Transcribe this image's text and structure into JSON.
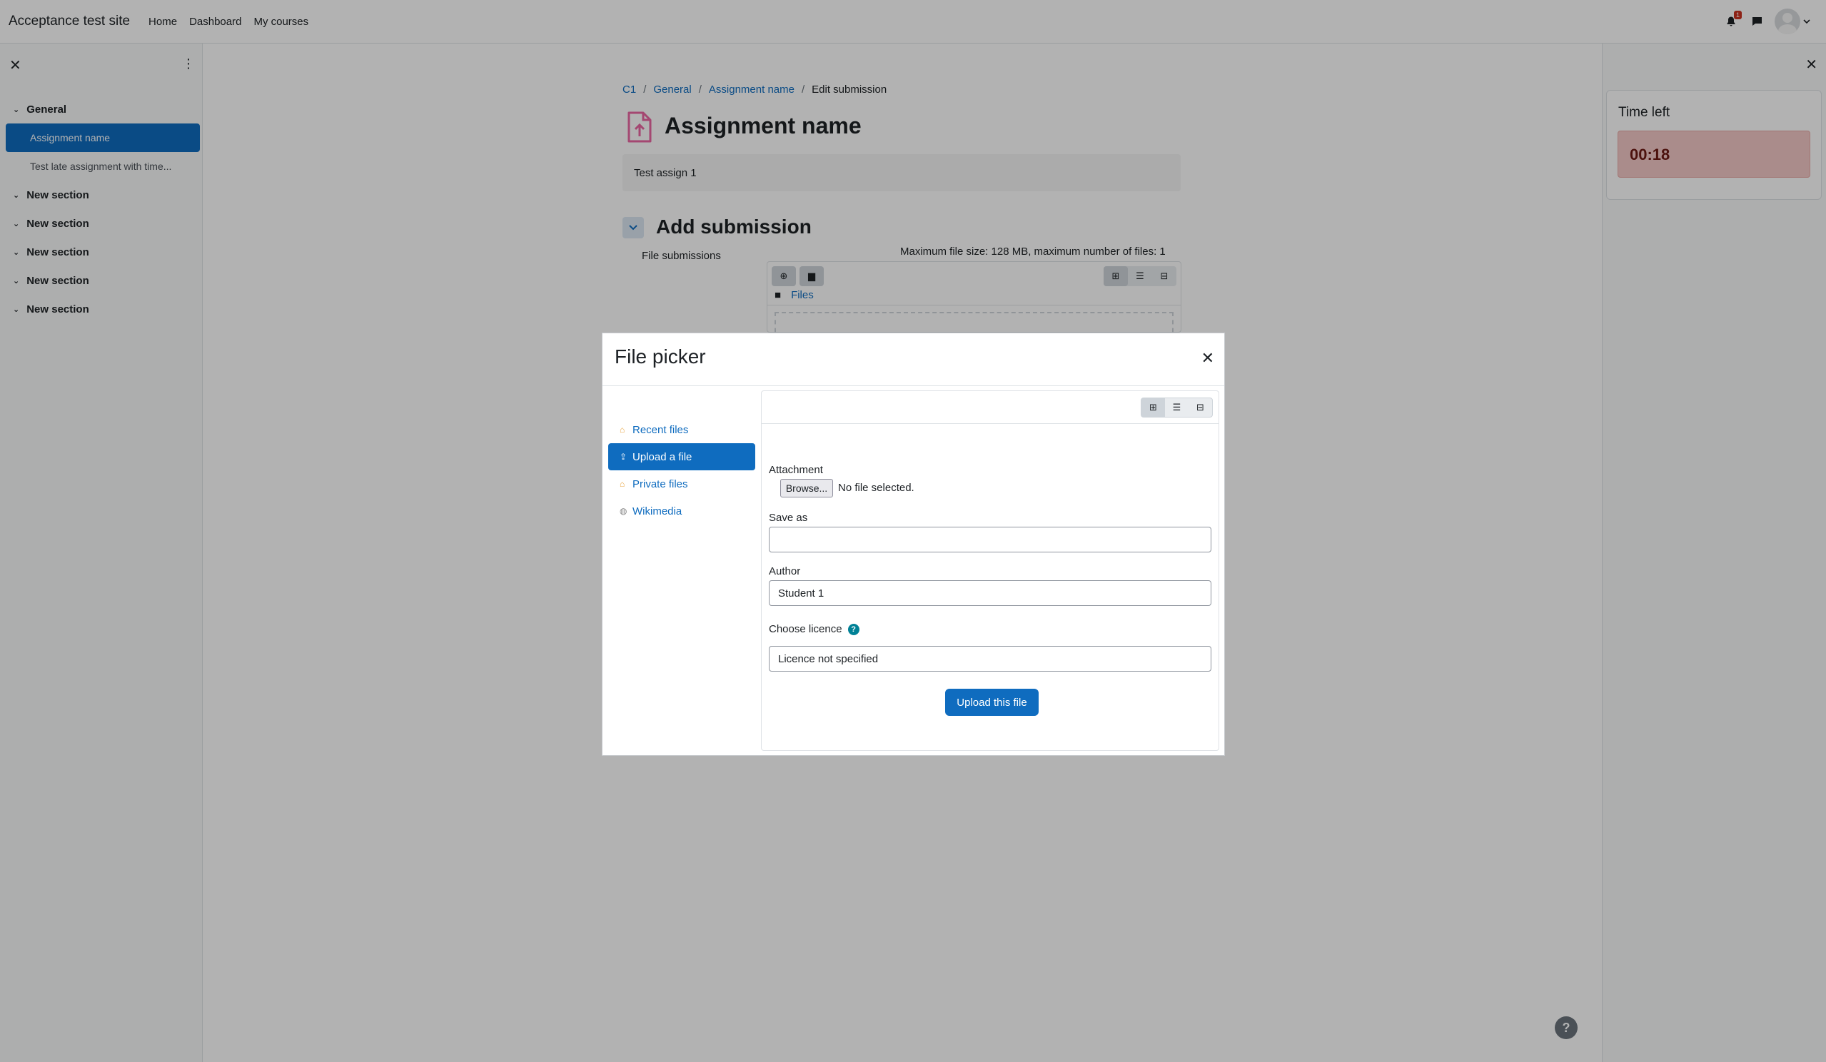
{
  "navbar": {
    "site_name": "Acceptance test site",
    "links": [
      "Home",
      "Dashboard",
      "My courses"
    ],
    "notification_count": "1"
  },
  "course_index": {
    "sections": [
      {
        "label": "General",
        "items": [
          "Assignment name",
          "Test late assignment with time..."
        ]
      },
      {
        "label": "New section"
      },
      {
        "label": "New section"
      },
      {
        "label": "New section"
      },
      {
        "label": "New section"
      },
      {
        "label": "New section"
      }
    ],
    "active_item": "Assignment name"
  },
  "breadcrumb": [
    "C1",
    "General",
    "Assignment name",
    "Edit submission"
  ],
  "page": {
    "title": "Assignment name",
    "intro": "Test assign 1",
    "section_heading": "Add submission",
    "file_submissions_label": "File submissions",
    "max_info": "Maximum file size: 128 MB, maximum number of files: 1",
    "files_path": "Files"
  },
  "timer": {
    "title": "Time left",
    "value": "00:18"
  },
  "file_picker": {
    "title": "File picker",
    "repositories": [
      {
        "label": "Recent files",
        "icon": "recent-files-icon"
      },
      {
        "label": "Upload a file",
        "icon": "upload-icon"
      },
      {
        "label": "Private files",
        "icon": "private-files-icon"
      },
      {
        "label": "Wikimedia",
        "icon": "wikimedia-icon"
      }
    ],
    "active_repository": "Upload a file",
    "attachment_label": "Attachment",
    "browse_label": "Browse...",
    "no_file_text": "No file selected.",
    "save_as_label": "Save as",
    "save_as_value": "",
    "author_label": "Author",
    "author_value": "Student 1",
    "licence_label": "Choose licence",
    "licence_value": "Licence not specified",
    "upload_button": "Upload this file"
  },
  "colors": {
    "primary": "#0f6cbf",
    "timer_bg": "#f4c9c7",
    "timer_text": "#6e1a15",
    "activity_icon": "#eb66a2"
  }
}
